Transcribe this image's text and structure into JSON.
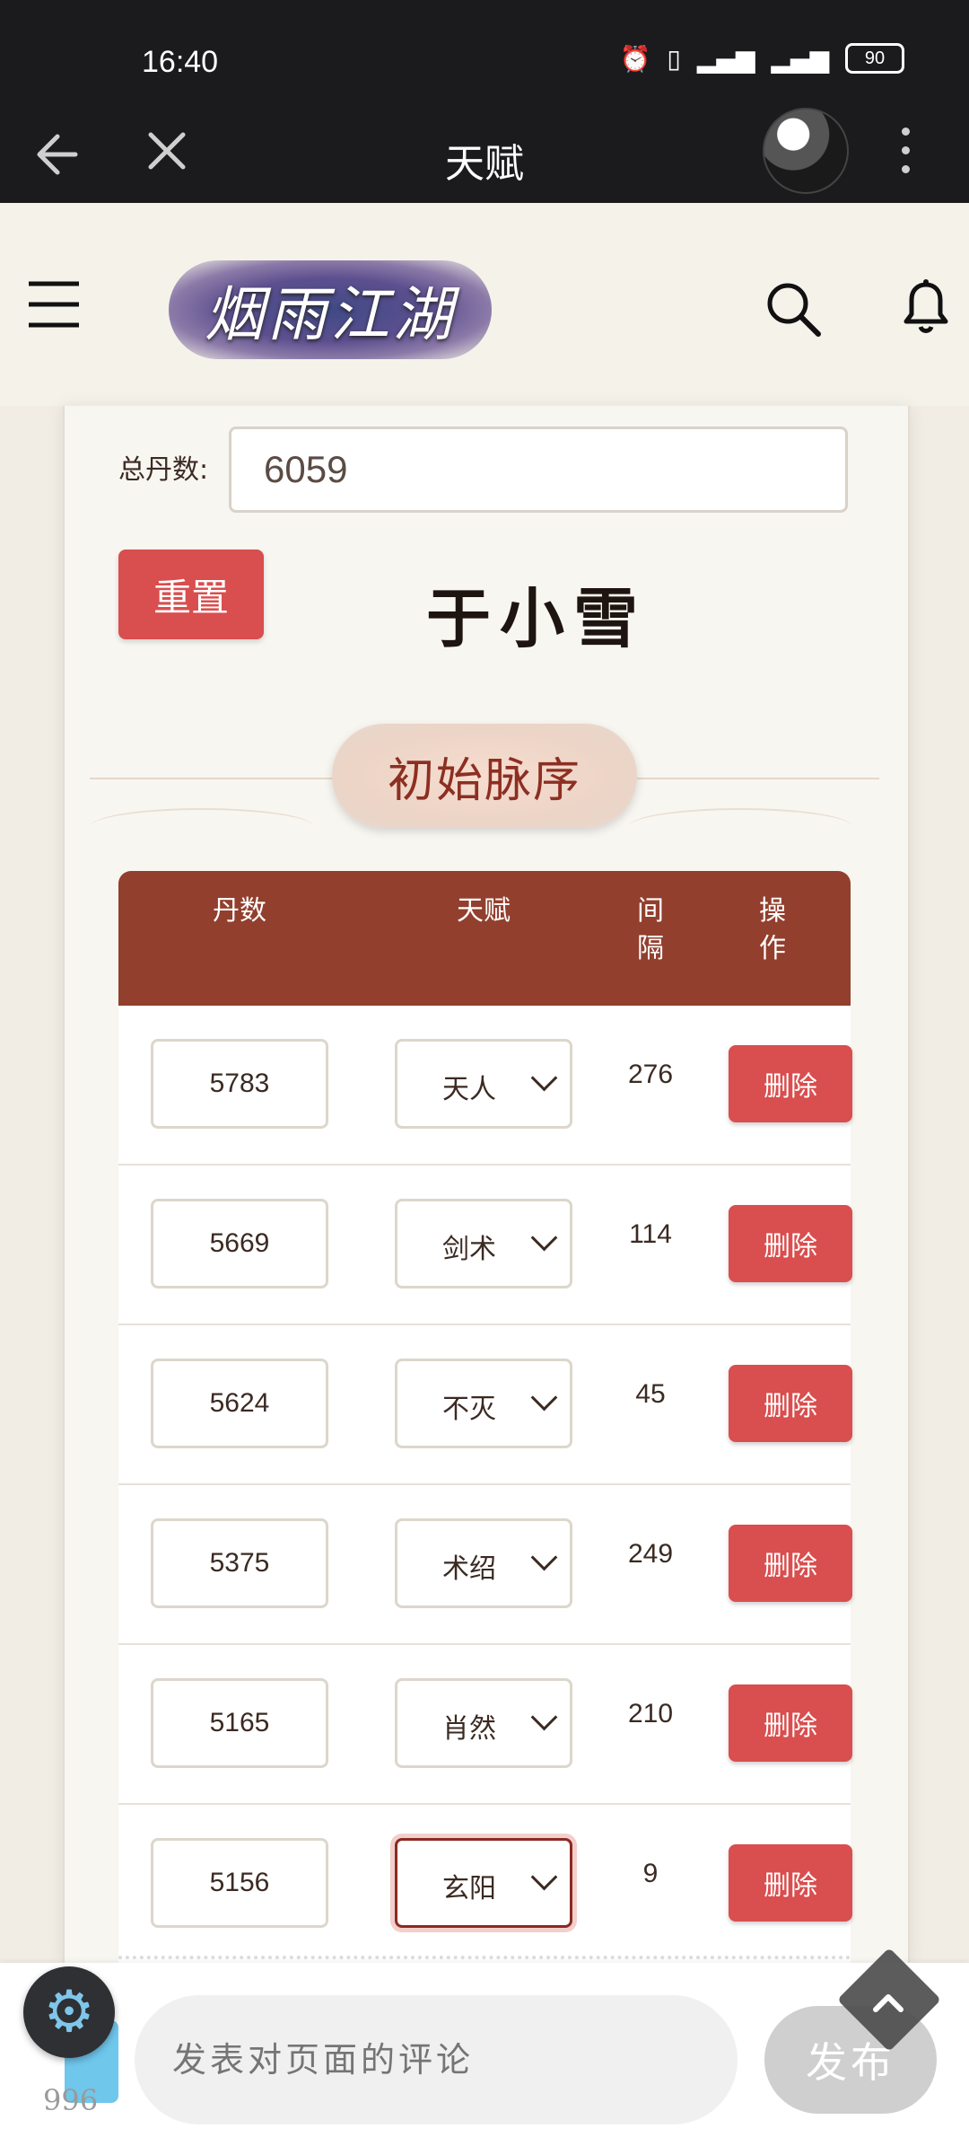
{
  "status_bar": {
    "time": "16:40",
    "battery": "90"
  },
  "title_bar": {
    "title": "天赋"
  },
  "site": {
    "logo_text": "烟雨江湖"
  },
  "form": {
    "total_label": "总丹数:",
    "total_value": "6059",
    "reset_label": "重置"
  },
  "character": {
    "name": "于小雪"
  },
  "section": {
    "title": "初始脉序"
  },
  "table": {
    "headers": {
      "dan": "丹数",
      "talent": "天赋",
      "gap_line1": "间",
      "gap_line2": "隔",
      "op_line1": "操",
      "op_line2": "作"
    },
    "rows": [
      {
        "dan": "5783",
        "talent": "天人",
        "gap": "276",
        "action": "删除"
      },
      {
        "dan": "5669",
        "talent": "剑术",
        "gap": "114",
        "action": "删除"
      },
      {
        "dan": "5624",
        "talent": "不灭",
        "gap": "45",
        "action": "删除"
      },
      {
        "dan": "5375",
        "talent": "术绍",
        "gap": "249",
        "action": "删除"
      },
      {
        "dan": "5165",
        "talent": "肖然",
        "gap": "210",
        "action": "删除"
      },
      {
        "dan": "5156",
        "talent": "玄阳",
        "gap": "9",
        "action": "删除"
      }
    ]
  },
  "comment": {
    "placeholder": "发表对页面的评论",
    "publish_label": "发布",
    "count": "996"
  },
  "colors": {
    "accent": "#923f2e",
    "button_red": "#d94e4e",
    "page_bg": "#f1ece4"
  }
}
